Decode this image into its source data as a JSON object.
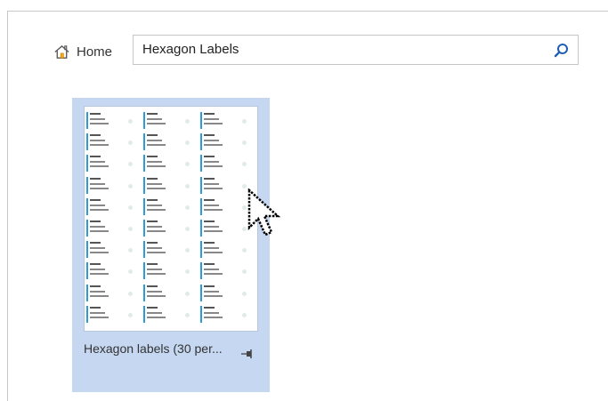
{
  "nav": {
    "home_label": "Home"
  },
  "search": {
    "value": "Hexagon Labels"
  },
  "results": [
    {
      "caption": "Hexagon labels (30 per...",
      "thumbnail": {
        "columns": 3,
        "rows": 10
      }
    }
  ],
  "icons": {
    "home": "home-icon",
    "search": "search-icon",
    "pin": "pin-icon",
    "cursor": "mouse-pointer"
  },
  "colors": {
    "tile_selected_bg": "#c5d7f1",
    "label_accent": "#2e9bd6",
    "search_icon": "#1e5fb4"
  }
}
